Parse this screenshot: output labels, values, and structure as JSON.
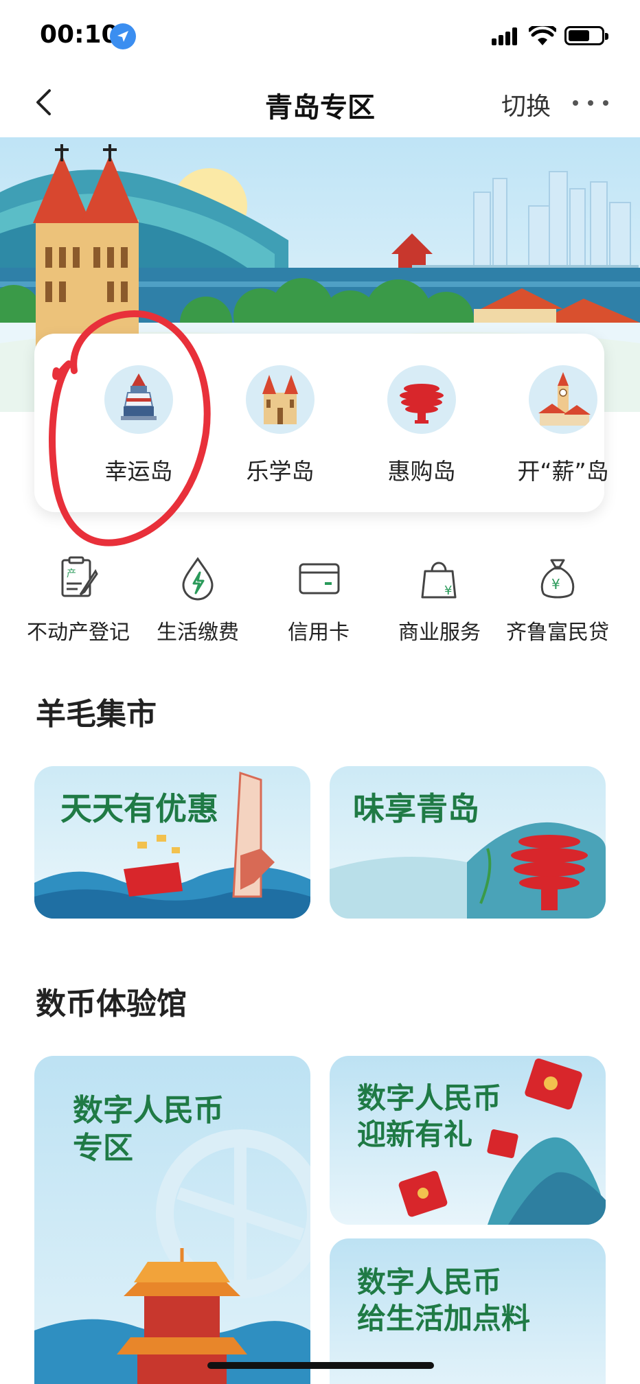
{
  "status_bar": {
    "time": "00:10"
  },
  "nav": {
    "title": "青岛专区",
    "switch_label": "切换"
  },
  "islands": [
    {
      "label": "幸运岛",
      "icon": "lighthouse-icon"
    },
    {
      "label": "乐学岛",
      "icon": "church-icon"
    },
    {
      "label": "惠购岛",
      "icon": "may-wind-sculpture-icon"
    },
    {
      "label": "开“薪”岛",
      "icon": "clock-tower-icon"
    }
  ],
  "services": [
    {
      "label": "不动产登记",
      "icon": "property-registration-icon"
    },
    {
      "label": "生活缴费",
      "icon": "utility-payment-icon"
    },
    {
      "label": "信用卡",
      "icon": "credit-card-icon"
    },
    {
      "label": "商业服务",
      "icon": "shopping-bag-icon"
    },
    {
      "label": "齐鲁富民贷",
      "icon": "money-bag-icon"
    }
  ],
  "sections": {
    "deals_title": "羊毛集市",
    "digital_title": "数币体验馆"
  },
  "deal_cards": [
    {
      "title": "天天有优惠"
    },
    {
      "title": "味享青岛"
    }
  ],
  "digital_cards": [
    {
      "line1": "数字人民币",
      "line2": "专区"
    },
    {
      "line1": "数字人民币",
      "line2": "迎新有礼"
    },
    {
      "line1": "数字人民币",
      "line2": "给生活加点料"
    }
  ],
  "colors": {
    "accent_green": "#1f7a45",
    "annotation_red": "#e8303a",
    "sky_blue": "#bfe3f5"
  }
}
